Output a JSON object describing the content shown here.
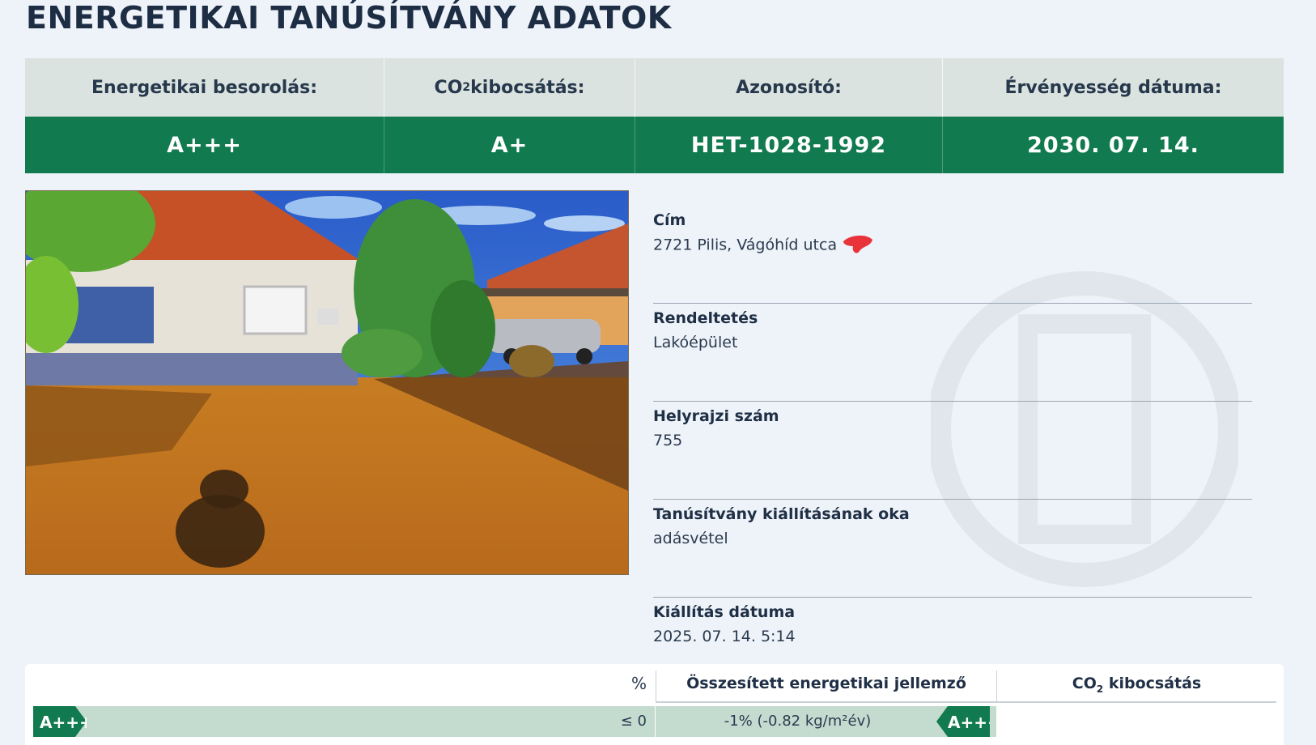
{
  "page": {
    "title": "ENERGETIKAI TANÚSÍTVÁNY ADATOK"
  },
  "summary": {
    "headers": {
      "rating": "Energetikai besorolás:",
      "co2_prefix": "CO",
      "co2_sub": "2",
      "co2_suffix": " kibocsátás:",
      "id": "Azonosító:",
      "validity": "Érvényesség dátuma:"
    },
    "values": {
      "rating": "A+++",
      "co2": "A+",
      "id": "HET-1028-1992",
      "validity": "2030. 07. 14."
    }
  },
  "details": {
    "address": {
      "label": "Cím",
      "value": "2721 Pilis, Vágóhíd utca"
    },
    "purpose": {
      "label": "Rendeltetés",
      "value": "Lakóépület"
    },
    "parcel": {
      "label": "Helyrajzi szám",
      "value": "755"
    },
    "reason": {
      "label": "Tanúsítvány kiállításának oka",
      "value": "adásvétel"
    },
    "issued": {
      "label": "Kiállítás dátuma",
      "value": "2025. 07. 14. 5:14"
    }
  },
  "scale": {
    "pct_header": "%",
    "energy_header": "Összesített energetikai jellemző",
    "co2_prefix": "CO",
    "co2_sub": "2",
    "co2_suffix": " kibocsátás",
    "rows": [
      {
        "class": "A+++",
        "range": "≤ 0",
        "energy_value": "-1% (-0.82 kg/m²év)",
        "marker": "A+++"
      }
    ]
  },
  "colors": {
    "brand_green": "#117a4e",
    "header_bg": "#dae3df",
    "scale_row": "#c4dccf",
    "redaction": "#e8333a"
  },
  "icons": {
    "redaction": "redaction-mark-icon"
  }
}
